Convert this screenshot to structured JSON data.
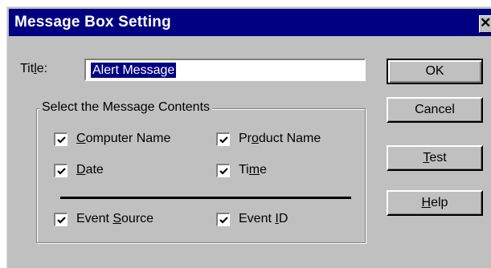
{
  "window": {
    "title": "Message Box Setting",
    "close_glyph": "✕"
  },
  "title_field": {
    "label_prefix": "Tit",
    "label_mnemonic": "l",
    "label_suffix": "e:",
    "value": "Alert Message"
  },
  "group": {
    "legend": "Select the Message Contents",
    "items": [
      {
        "pre": "",
        "mn": "C",
        "post": "omputer Name",
        "checked": true
      },
      {
        "pre": "Pr",
        "mn": "o",
        "post": "duct Name",
        "checked": true
      },
      {
        "pre": "",
        "mn": "D",
        "post": "ate",
        "checked": true
      },
      {
        "pre": "Ti",
        "mn": "m",
        "post": "e",
        "checked": true
      },
      {
        "pre": "Event ",
        "mn": "S",
        "post": "ource",
        "checked": true
      },
      {
        "pre": "Event ",
        "mn": "I",
        "post": "D",
        "checked": true
      }
    ]
  },
  "buttons": {
    "ok": {
      "pre": "OK",
      "mn": "",
      "post": ""
    },
    "cancel": {
      "pre": "Cancel",
      "mn": "",
      "post": ""
    },
    "test": {
      "pre": "",
      "mn": "T",
      "post": "est"
    },
    "help": {
      "pre": "",
      "mn": "H",
      "post": "elp"
    }
  }
}
